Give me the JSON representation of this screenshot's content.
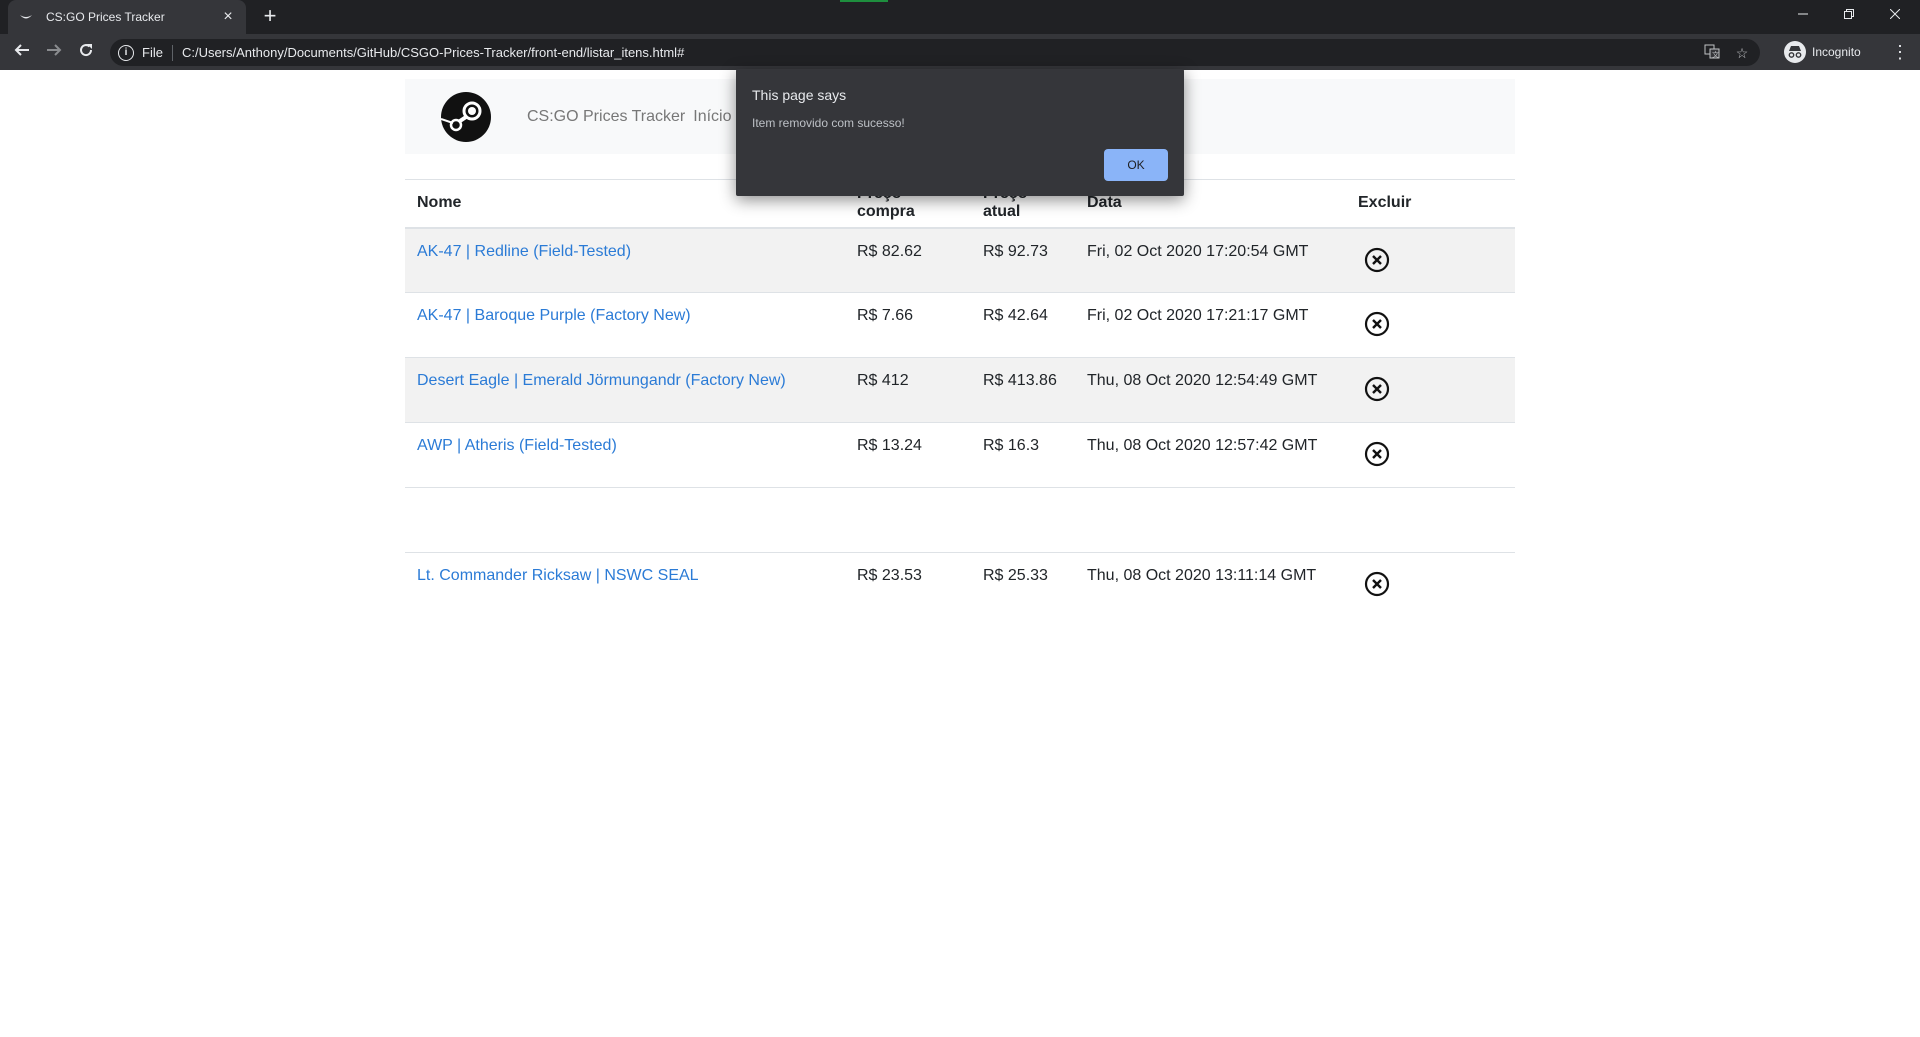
{
  "browser": {
    "tab_title": "CS:GO Prices Tracker",
    "tab_close_glyph": "×",
    "new_tab_glyph": "+",
    "scheme_label": "File",
    "url": "C:/Users/Anthony/Documents/GitHub/CSGO-Prices-Tracker/front-end/listar_itens.html#",
    "profile_label": "Incognito",
    "accent_green": "#1e8e3e"
  },
  "navbar": {
    "brand": "CS:GO Prices Tracker",
    "link_inicio": "Início",
    "link_partial": "I"
  },
  "table": {
    "headers": {
      "name": "Nome",
      "buy_price": "Preço compra",
      "current_price": "Preço atual",
      "date": "Data",
      "delete": "Excluir"
    },
    "rows": [
      {
        "name": "AK-47 | Redline (Field-Tested)",
        "buy_price": "R$ 82.62",
        "current_price": "R$ 92.73",
        "date": "Fri, 02 Oct 2020 17:20:54 GMT"
      },
      {
        "name": "AK-47 | Baroque Purple (Factory New)",
        "buy_price": "R$ 7.66",
        "current_price": "R$ 42.64",
        "date": "Fri, 02 Oct 2020 17:21:17 GMT"
      },
      {
        "name": "Desert Eagle | Emerald Jörmungandr (Factory New)",
        "buy_price": "R$ 412",
        "current_price": "R$ 413.86",
        "date": "Thu, 08 Oct 2020 12:54:49 GMT"
      },
      {
        "name": "AWP | Atheris (Field-Tested)",
        "buy_price": "R$ 13.24",
        "current_price": "R$ 16.3",
        "date": "Thu, 08 Oct 2020 12:57:42 GMT"
      },
      {
        "name": "Lt. Commander Ricksaw | NSWC SEAL",
        "buy_price": "R$ 23.53",
        "current_price": "R$ 25.33",
        "date": "Thu, 08 Oct 2020 13:11:14 GMT"
      }
    ],
    "link_color": "#2b7bd6"
  },
  "dialog": {
    "title": "This page says",
    "message": "Item removido com sucesso!",
    "ok_label": "OK",
    "ok_color": "#8ab4f8"
  }
}
